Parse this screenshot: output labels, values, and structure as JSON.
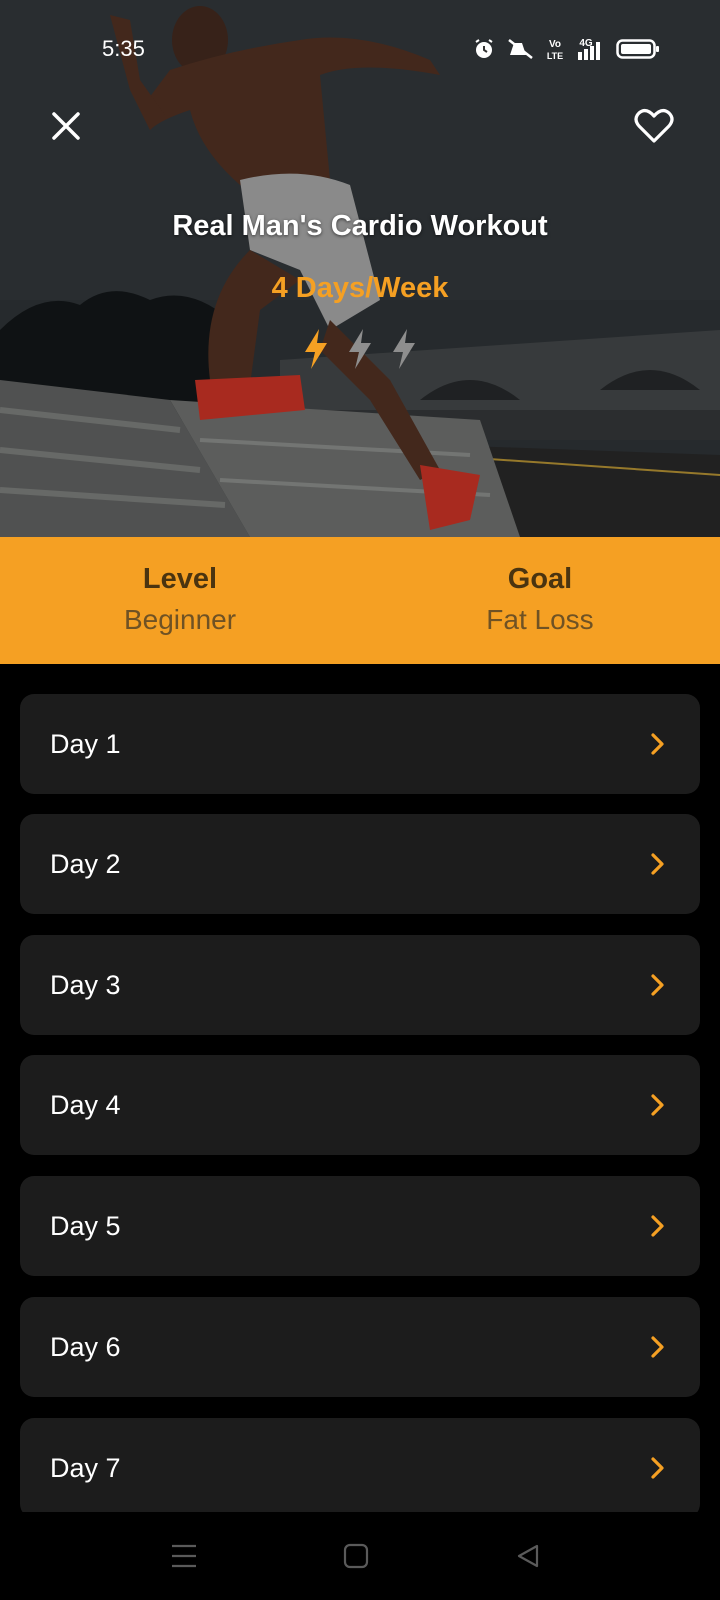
{
  "status_bar": {
    "time": "5:35",
    "icons": [
      "alarm-icon",
      "mute-icon",
      "volte-icon",
      "signal-4g-icon",
      "battery-icon"
    ],
    "volte_label": "Vo LTE",
    "network_label": "4G"
  },
  "header": {
    "title": "Real Man's Cardio Workout",
    "frequency": "4 Days/Week",
    "intensity_level": 1,
    "intensity_max": 3
  },
  "info": {
    "level_label": "Level",
    "level_value": "Beginner",
    "goal_label": "Goal",
    "goal_value": "Fat Loss"
  },
  "days": [
    {
      "label": "Day 1"
    },
    {
      "label": "Day 2"
    },
    {
      "label": "Day 3"
    },
    {
      "label": "Day 4"
    },
    {
      "label": "Day 5"
    },
    {
      "label": "Day 6"
    },
    {
      "label": "Day 7"
    }
  ],
  "colors": {
    "accent": "#f5a023",
    "row_bg": "#1c1c1c",
    "page_bg": "#000000"
  }
}
